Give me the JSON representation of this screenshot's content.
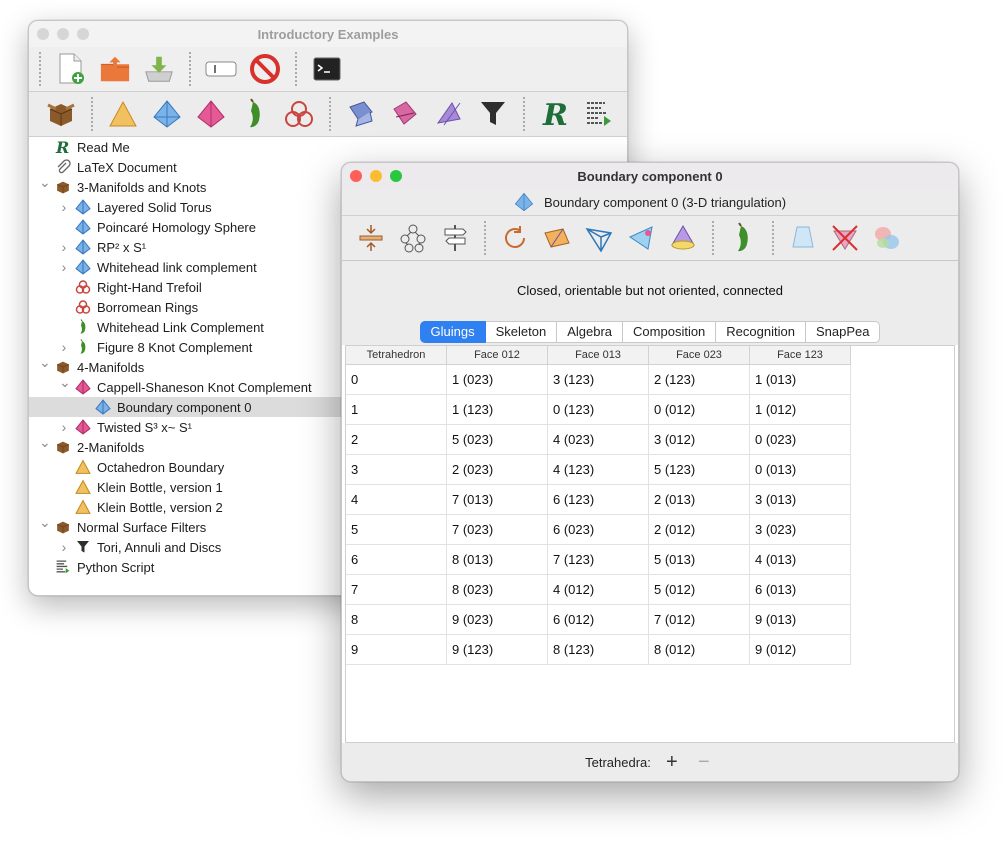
{
  "back_window": {
    "title": "Introductory Examples",
    "toolbar1": [
      "new-file-icon",
      "open-folder-icon",
      "save-download-icon",
      "rename-field-icon",
      "stop-icon",
      "terminal-icon"
    ],
    "toolbar2": [
      "container-box-icon",
      "triangle-2d-icon",
      "tetrahedron-3d-icon",
      "pink-tetrahedron-4d-icon",
      "pepper-knot-icon",
      "trefoil-link-icon",
      "attachment-icon",
      "surfaces-icon",
      "angle-structures-icon",
      "filter-funnel-icon",
      "r-script-icon",
      "python-script-icon"
    ],
    "tree": [
      {
        "label": "Read Me",
        "depth": 0,
        "chevron": "",
        "icon": "r-icon"
      },
      {
        "label": "LaTeX Document",
        "depth": 0,
        "chevron": "",
        "icon": "paperclip-icon"
      },
      {
        "label": "3-Manifolds and Knots",
        "depth": 0,
        "chevron": "v",
        "icon": "box-icon"
      },
      {
        "label": "Layered Solid Torus",
        "depth": 1,
        "chevron": ">",
        "icon": "blue-tetrahedron-icon"
      },
      {
        "label": "Poincaré Homology Sphere",
        "depth": 1,
        "chevron": "",
        "icon": "blue-tetrahedron-icon"
      },
      {
        "label": "RP² x S¹",
        "depth": 1,
        "chevron": ">",
        "icon": "blue-tetrahedron-icon"
      },
      {
        "label": "Whitehead link complement",
        "depth": 1,
        "chevron": ">",
        "icon": "blue-tetrahedron-icon"
      },
      {
        "label": "Right-Hand Trefoil",
        "depth": 1,
        "chevron": "",
        "icon": "knot-icon"
      },
      {
        "label": "Borromean Rings",
        "depth": 1,
        "chevron": "",
        "icon": "knot-icon"
      },
      {
        "label": "Whitehead Link Complement",
        "depth": 1,
        "chevron": "",
        "icon": "pepper-icon"
      },
      {
        "label": "Figure 8 Knot Complement",
        "depth": 1,
        "chevron": ">",
        "icon": "pepper-icon"
      },
      {
        "label": "4-Manifolds",
        "depth": 0,
        "chevron": "v",
        "icon": "box-icon"
      },
      {
        "label": "Cappell-Shaneson Knot Complement",
        "depth": 1,
        "chevron": "v",
        "icon": "pink-tetrahedron-icon"
      },
      {
        "label": "Boundary component 0",
        "depth": 2,
        "chevron": "",
        "icon": "blue-tetrahedron-icon",
        "selected": true
      },
      {
        "label": "Twisted S³ x~ S¹",
        "depth": 1,
        "chevron": ">",
        "icon": "pink-tetrahedron-icon"
      },
      {
        "label": "2-Manifolds",
        "depth": 0,
        "chevron": "v",
        "icon": "box-icon"
      },
      {
        "label": "Octahedron Boundary",
        "depth": 1,
        "chevron": "",
        "icon": "triangle-icon"
      },
      {
        "label": "Klein Bottle, version 1",
        "depth": 1,
        "chevron": "",
        "icon": "triangle-icon"
      },
      {
        "label": "Klein Bottle, version 2",
        "depth": 1,
        "chevron": "",
        "icon": "triangle-icon"
      },
      {
        "label": "Normal Surface Filters",
        "depth": 0,
        "chevron": "v",
        "icon": "box-icon"
      },
      {
        "label": "Tori, Annuli and Discs",
        "depth": 1,
        "chevron": ">",
        "icon": "funnel-icon"
      },
      {
        "label": "Python Script",
        "depth": 0,
        "chevron": "",
        "icon": "script-icon"
      }
    ]
  },
  "front_window": {
    "title": "Boundary component 0",
    "subtitle": "Boundary component 0 (3-D triangulation)",
    "toolbar": [
      "insert-icon",
      "graph-icon",
      "signpost-icon",
      "rotate-icon",
      "double-cover-icon",
      "tetrahedron-wire-icon",
      "ideal-vertex-icon",
      "puncture-icon",
      "pepper-icon",
      "cone-icon",
      "no-boundary-icon",
      "blobs-icon"
    ],
    "status": "Closed, orientable but not oriented, connected",
    "tabs": [
      "Gluings",
      "Skeleton",
      "Algebra",
      "Composition",
      "Recognition",
      "SnapPea"
    ],
    "active_tab": "Gluings",
    "columns": [
      "Tetrahedron",
      "Face 012",
      "Face 013",
      "Face 023",
      "Face 123"
    ],
    "rows": [
      [
        "0",
        "1 (023)",
        "3 (123)",
        "2 (123)",
        "1 (013)"
      ],
      [
        "1",
        "1 (123)",
        "0 (123)",
        "0 (012)",
        "1 (012)"
      ],
      [
        "2",
        "5 (023)",
        "4 (023)",
        "3 (012)",
        "0 (023)"
      ],
      [
        "3",
        "2 (023)",
        "4 (123)",
        "5 (123)",
        "0 (013)"
      ],
      [
        "4",
        "7 (013)",
        "6 (123)",
        "2 (013)",
        "3 (013)"
      ],
      [
        "5",
        "7 (023)",
        "6 (023)",
        "2 (012)",
        "3 (023)"
      ],
      [
        "6",
        "8 (013)",
        "7 (123)",
        "5 (013)",
        "4 (013)"
      ],
      [
        "7",
        "8 (023)",
        "4 (012)",
        "5 (012)",
        "6 (013)"
      ],
      [
        "8",
        "9 (023)",
        "6 (012)",
        "7 (012)",
        "9 (013)"
      ],
      [
        "9",
        "9 (123)",
        "8 (123)",
        "8 (012)",
        "9 (012)"
      ]
    ],
    "footer_label": "Tetrahedra:",
    "add_label": "+",
    "remove_label": "−"
  }
}
